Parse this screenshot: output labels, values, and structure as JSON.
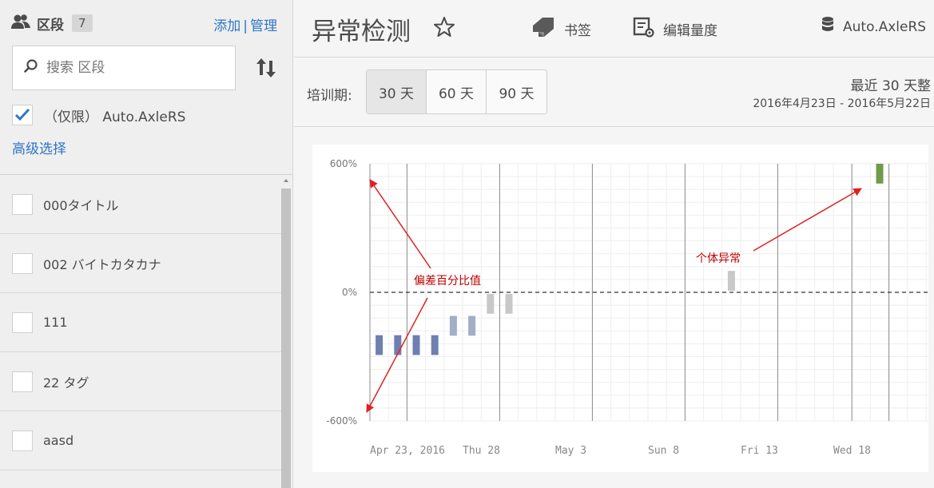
{
  "sidebar": {
    "title": "区段",
    "count": "7",
    "add_label": "添加",
    "separator": "|",
    "manage_label": "管理",
    "search_placeholder": "搜索 区段",
    "filter_label": "（仅限） Auto.AxleRS",
    "filter_checked": true,
    "advanced_label": "高级选择",
    "items": [
      {
        "label": "000タイトル",
        "checked": false
      },
      {
        "label": "002 バイトカタカナ",
        "checked": false
      },
      {
        "label": "111",
        "checked": false
      },
      {
        "label": "22 タグ",
        "checked": false
      },
      {
        "label": "aasd",
        "checked": false
      }
    ]
  },
  "header": {
    "title": "异常检测",
    "bookmark_label": "书签",
    "edit_metrics_label": "编辑量度",
    "report_suite_label": "Auto.AxleRS"
  },
  "training": {
    "label": "培训期:",
    "options": [
      "30 天",
      "60 天",
      "90 天"
    ],
    "selected": "30 天",
    "range_title": "最近 30 天整",
    "range_dates": "2016年4月23日 - 2016年5月22日"
  },
  "colors": {
    "accent_blue": "#2d76c8",
    "bar_negative": "#6f7fb0",
    "bar_light": "#a3aec9",
    "bar_gray": "#c8c8c8",
    "bar_anomaly": "#6f9b4a",
    "annotation_red": "#e02020"
  },
  "chart_data": {
    "type": "bar",
    "y_tick_labels": [
      "600%",
      "0%",
      "-600%"
    ],
    "ylim": [
      -600,
      600
    ],
    "x_tick_labels": [
      "Apr 23, 2016",
      "Thu 28",
      "May 3",
      "Sun 8",
      "Fri 13",
      "Wed 18"
    ],
    "series": [
      {
        "points": [
          {
            "day": 0,
            "value": -300
          },
          {
            "day": 1,
            "value": -300
          },
          {
            "day": 2,
            "value": -300
          },
          {
            "day": 3,
            "value": -300
          },
          {
            "day": 4,
            "value": -200
          },
          {
            "day": 5,
            "value": -200
          },
          {
            "day": 6,
            "value": -100
          },
          {
            "day": 7,
            "value": -100
          },
          {
            "day": 19,
            "value": 100
          },
          {
            "day": 27,
            "value": 500
          }
        ]
      }
    ],
    "annotations": [
      {
        "text": "偏差百分比值"
      },
      {
        "text": "个体异常"
      }
    ]
  }
}
